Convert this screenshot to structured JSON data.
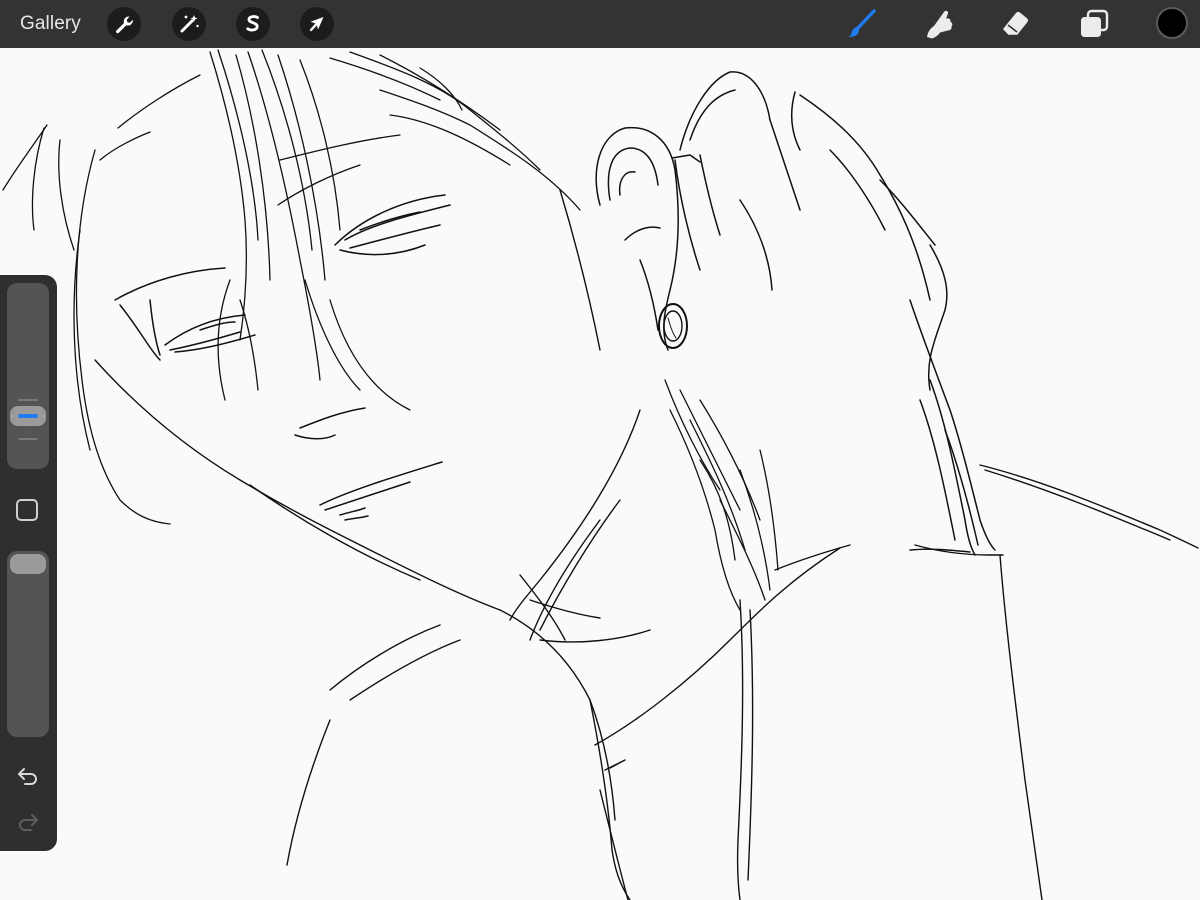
{
  "toolbar": {
    "gallery_label": "Gallery",
    "left_tools": [
      {
        "icon": "wrench-icon",
        "name": "actions"
      },
      {
        "icon": "magic-wand-icon",
        "name": "adjustments"
      },
      {
        "icon": "selection-s-icon",
        "name": "selection"
      },
      {
        "icon": "arrow-cursor-icon",
        "name": "transform"
      }
    ],
    "right_tools": [
      {
        "icon": "brush-icon",
        "name": "paint",
        "active": true
      },
      {
        "icon": "smudge-finger-icon",
        "name": "smudge"
      },
      {
        "icon": "eraser-icon",
        "name": "erase"
      },
      {
        "icon": "layers-icon",
        "name": "layers"
      }
    ],
    "current_color": "#000000"
  },
  "sidebar": {
    "brush_size_level": 0.25,
    "opacity_level": 1.0,
    "modify_button_icon": "square-icon",
    "undo_icon": "undo-arrow-icon",
    "redo_icon": "redo-arrow-icon"
  },
  "colors": {
    "toolbar_bg": "#333333",
    "canvas_bg": "#fafafa",
    "accent_blue": "#1e7cf2",
    "ink": "#111111"
  }
}
